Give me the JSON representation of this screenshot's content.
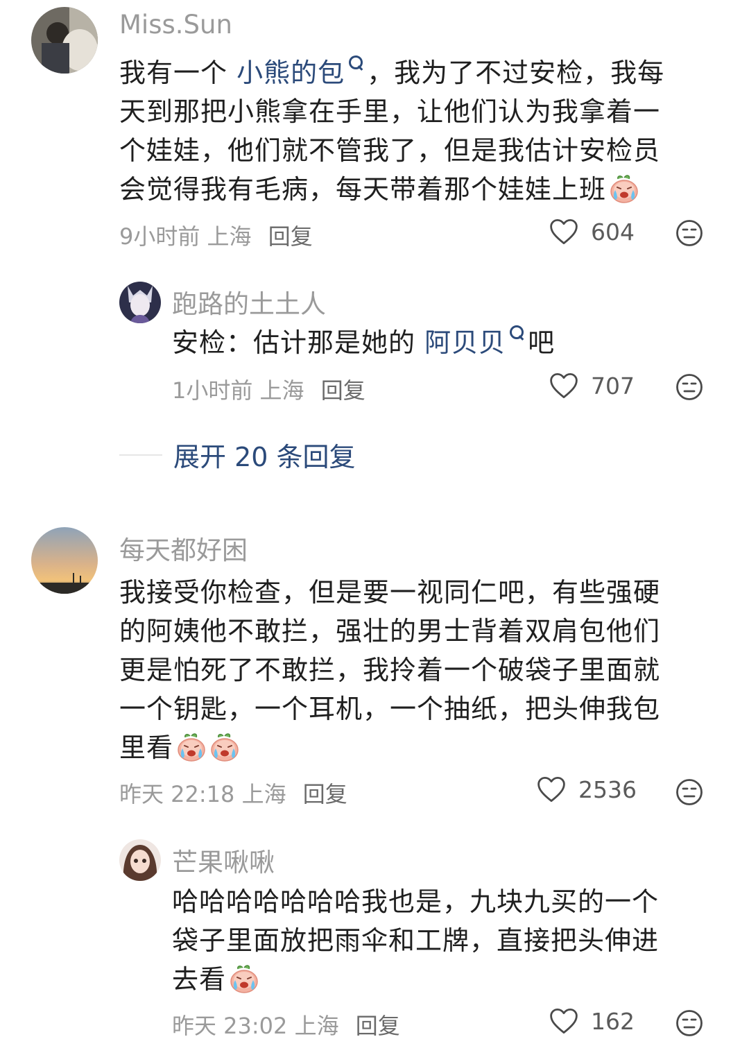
{
  "comments": [
    {
      "username": "Miss.Sun",
      "text_lines": [
        {
          "before": "我有一个 ",
          "link": "小熊的包",
          "after": "，我为了不过安检，我每"
        },
        {
          "before": "天到那把小熊拿在手里，让他们认为我拿着一"
        },
        {
          "before": "个娃娃，他们就不管我了，但是我估计安检员"
        },
        {
          "before": "会觉得我有毛病，每天带着那个娃娃上班",
          "emoji_count": 1
        }
      ],
      "time": "9小时前",
      "location": "上海",
      "reply_label": "回复",
      "likes": "604",
      "reply": {
        "username": "跑路的土土人",
        "text_lines": [
          {
            "before": "安检：估计那是她的 ",
            "link": "阿贝贝",
            "after": "吧"
          }
        ],
        "time": "1小时前",
        "location": "上海",
        "reply_label": "回复",
        "likes": "707"
      },
      "expand_label": "展开 20 条回复"
    },
    {
      "username": "每天都好困",
      "text_lines": [
        {
          "before": "我接受你检查，但是要一视同仁吧，有些强硬"
        },
        {
          "before": "的阿姨他不敢拦，强壮的男士背着双肩包他们"
        },
        {
          "before": "更是怕死了不敢拦，我拎着一个破袋子里面就"
        },
        {
          "before": "一个钥匙，一个耳机，一个抽纸，把头伸我包"
        },
        {
          "before": "里看",
          "emoji_count": 2
        }
      ],
      "time": "昨天 22:18",
      "location": "上海",
      "reply_label": "回复",
      "likes": "2536",
      "reply": {
        "username": "芒果啾啾",
        "text_lines": [
          {
            "before": "哈哈哈哈哈哈哈我也是，九块九买的一个"
          },
          {
            "before": "袋子里面放把雨伞和工牌，直接把头伸进"
          },
          {
            "before": "去看",
            "emoji_count": 1
          }
        ],
        "time": "昨天 23:02",
        "location": "上海",
        "reply_label": "回复",
        "likes": "162"
      }
    }
  ],
  "icons": {
    "like": "heart-outline-icon",
    "dislike": "meh-face-icon",
    "emoji": "crying-face-emoji",
    "search": "search-icon"
  },
  "colors": {
    "link": "#2b4a7a",
    "username": "#9a9a9a",
    "text": "#1f1f1f"
  }
}
